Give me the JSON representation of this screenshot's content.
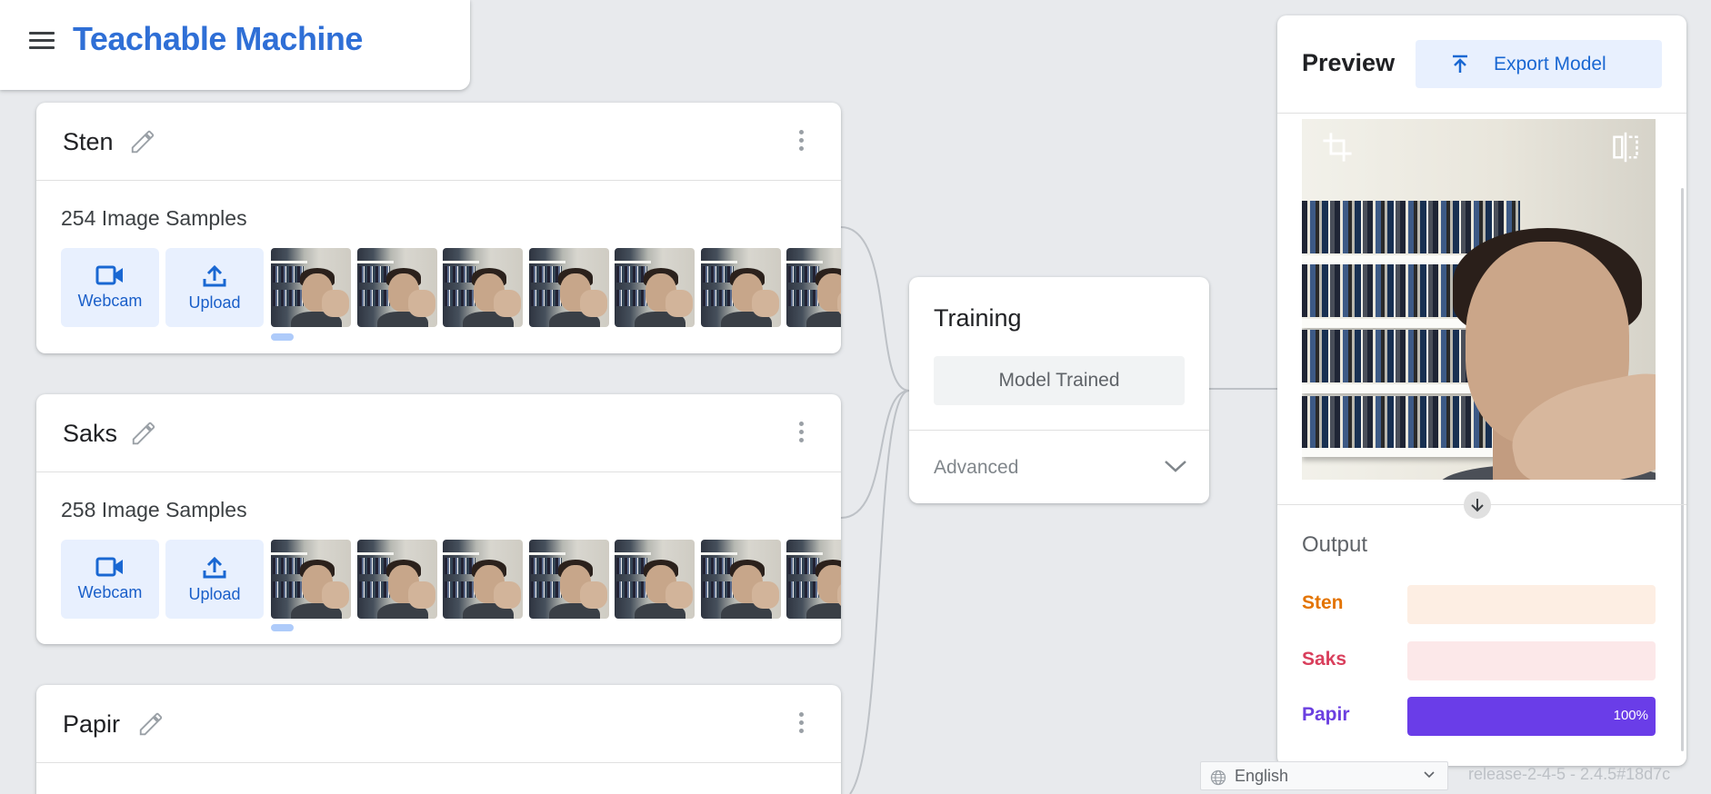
{
  "app": {
    "title": "Teachable Machine",
    "menu_icon": "menu-icon"
  },
  "classes": [
    {
      "name": "Sten",
      "sample_count": "254 Image Samples",
      "webcam_label": "Webcam",
      "upload_label": "Upload"
    },
    {
      "name": "Saks",
      "sample_count": "258 Image Samples",
      "webcam_label": "Webcam",
      "upload_label": "Upload"
    },
    {
      "name": "Papir",
      "sample_count": ""
    }
  ],
  "training": {
    "title": "Training",
    "status_button": "Model Trained",
    "advanced_label": "Advanced"
  },
  "preview": {
    "title": "Preview",
    "export_label": "Export Model",
    "output_title": "Output",
    "outputs": [
      {
        "label": "Sten",
        "percent": 0,
        "percent_label": "",
        "label_color": "#e37400",
        "track_color": "#fdeee3",
        "fill_color": "#f6a75c"
      },
      {
        "label": "Saks",
        "percent": 0,
        "percent_label": "",
        "label_color": "#d93f5c",
        "track_color": "#fce8e9",
        "fill_color": "#ee6b84"
      },
      {
        "label": "Papir",
        "percent": 100,
        "percent_label": "100%",
        "label_color": "#6b3fe0",
        "track_color": "#ece6fb",
        "fill_color": "#6a3de8"
      }
    ]
  },
  "footer": {
    "language": "English",
    "version": "release-2-4-5 - 2.4.5#18d7c"
  },
  "colors": {
    "accent": "#1967d2",
    "brand": "#2f6fd6",
    "background": "#e8eaed"
  }
}
